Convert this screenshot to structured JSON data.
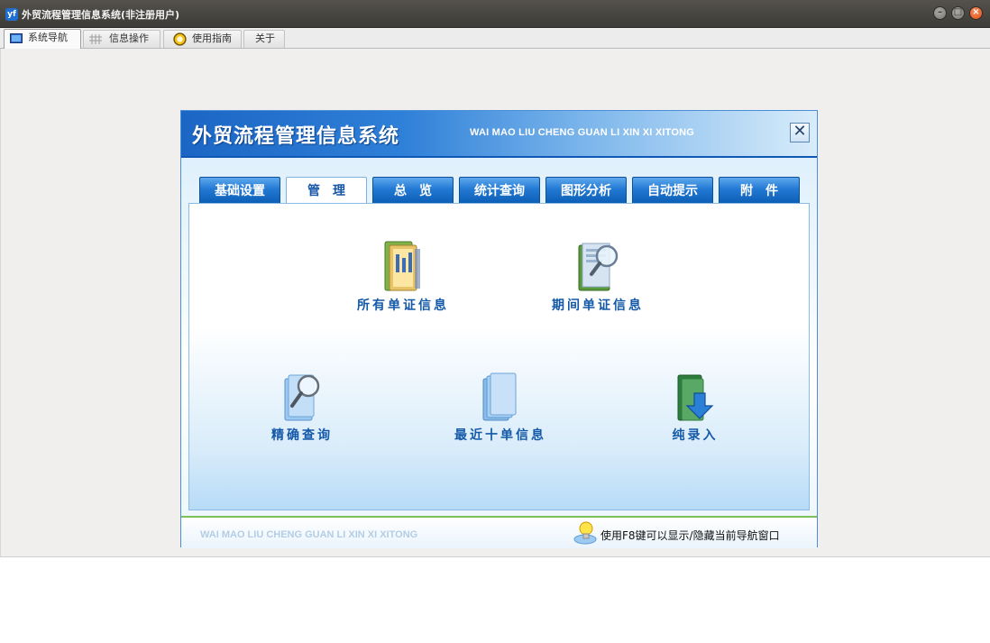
{
  "window": {
    "title": "外贸流程管理信息系统(非注册用户)",
    "logo_text": "yf",
    "buttons": [
      "minimize",
      "maximize",
      "close"
    ]
  },
  "tabs": [
    {
      "label": "系统导航",
      "icon": "monitor-icon",
      "active": true
    },
    {
      "label": "信息操作",
      "icon": "grid-icon",
      "active": false
    },
    {
      "label": "使用指南",
      "icon": "help-ring-icon",
      "active": false
    },
    {
      "label": "关于",
      "icon": "",
      "active": false
    }
  ],
  "dialog": {
    "title": "外贸流程管理信息系统",
    "subtitle": "WAI MAO LIU CHENG GUAN LI XIN XI XITONG",
    "close_label": "✕",
    "tabs": [
      {
        "label": "基础设置",
        "active": false
      },
      {
        "label": "管　理",
        "active": true
      },
      {
        "label": "总　览",
        "active": false
      },
      {
        "label": "统计查询",
        "active": false
      },
      {
        "label": "图形分析",
        "active": false
      },
      {
        "label": "自动提示",
        "active": false
      },
      {
        "label": "附　件",
        "active": false
      }
    ],
    "items": [
      {
        "label": "所有单证信息",
        "icon": "documents-icon"
      },
      {
        "label": "期间单证信息",
        "icon": "folder-search-icon"
      },
      {
        "label": "精确查询",
        "icon": "magnifier-folder-icon"
      },
      {
        "label": "最近十单信息",
        "icon": "folder-stack-icon"
      },
      {
        "label": "纯录入",
        "icon": "folder-download-icon"
      }
    ],
    "footer_text": "WAI MAO LIU CHENG GUAN LI XIN XI XITONG",
    "hint": "使用F8键可以显示/隐藏当前导航窗口",
    "colors": {
      "accent": "#2379d3",
      "label": "#1459a8",
      "footer_line": "#7dbf5a"
    }
  }
}
